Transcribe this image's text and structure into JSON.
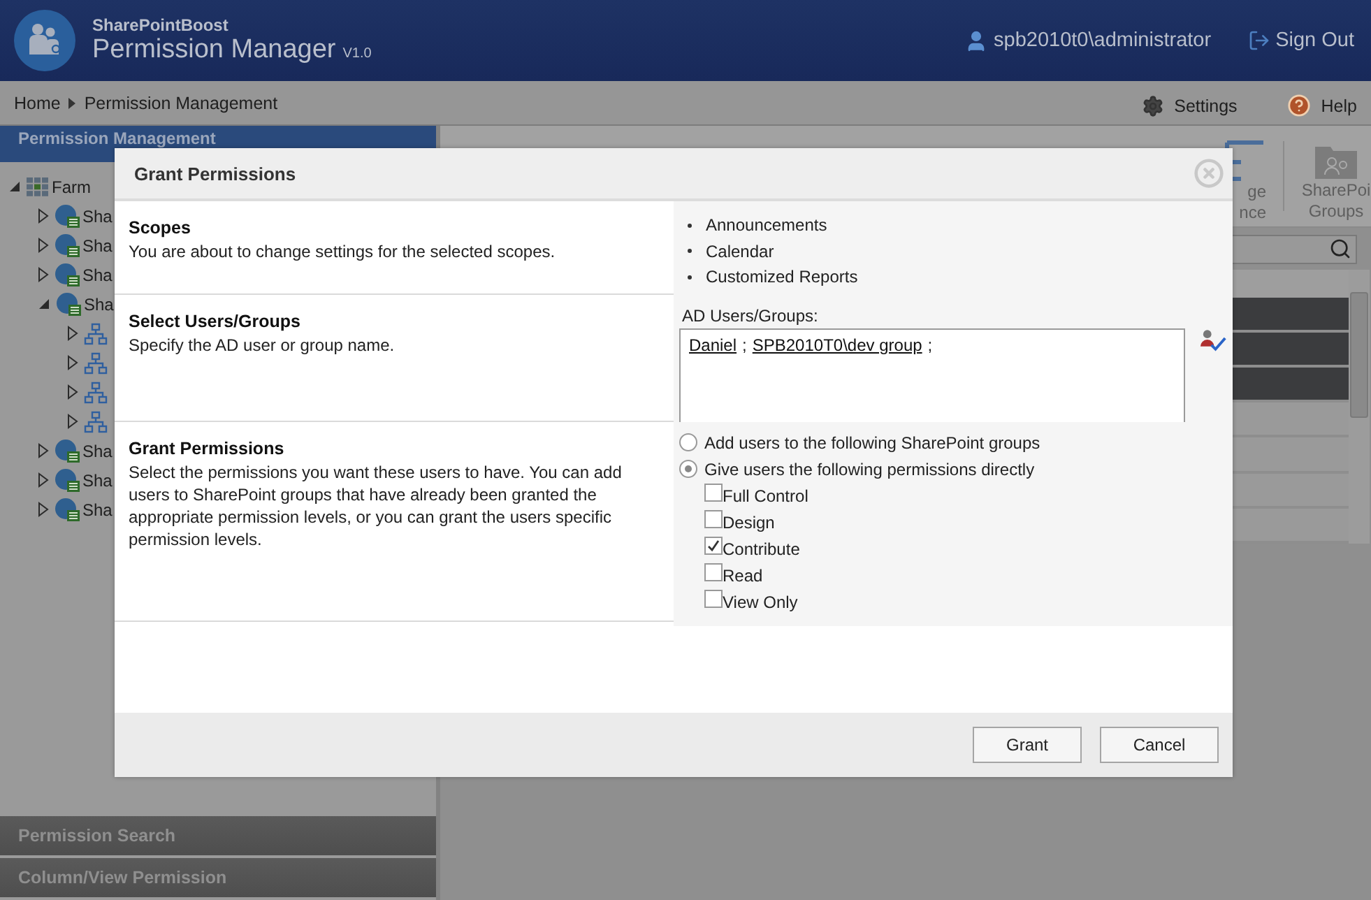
{
  "header": {
    "brand": "SharePointBoost",
    "product": "Permission Manager",
    "version": "V1.0",
    "user": "spb2010t0\\administrator",
    "sign_out": "Sign Out"
  },
  "breadcrumb": {
    "items": [
      "Home",
      "Permission Management"
    ],
    "settings": "Settings",
    "help": "Help"
  },
  "sidebar": {
    "title": "Permission Management",
    "tree": [
      {
        "label": "Farm",
        "kind": "farm",
        "expanded": true,
        "children": [
          {
            "label": "Sha",
            "kind": "site",
            "expanded": false
          },
          {
            "label": "Sha",
            "kind": "site",
            "expanded": false
          },
          {
            "label": "Sha",
            "kind": "site",
            "expanded": false
          },
          {
            "label": "Sha",
            "kind": "site",
            "expanded": true,
            "children": [
              {
                "kind": "web",
                "expanded": false
              },
              {
                "kind": "web",
                "expanded": false
              },
              {
                "kind": "web",
                "expanded": false
              },
              {
                "kind": "web",
                "expanded": false
              }
            ]
          },
          {
            "label": "Sha",
            "kind": "site",
            "expanded": false
          },
          {
            "label": "Sha",
            "kind": "site",
            "expanded": false
          },
          {
            "label": "Sha",
            "kind": "site",
            "expanded": false
          }
        ]
      }
    ],
    "panels": [
      "Permission Search",
      "Column/View Permission"
    ]
  },
  "toolbar": {
    "items": [
      {
        "kind": "inheritance",
        "lines": [
          "ge",
          "nce"
        ]
      },
      {
        "kind": "groups",
        "lines": [
          "SharePoi",
          "Groups"
        ]
      }
    ]
  },
  "list": {
    "rows": [
      {
        "selected": true
      },
      {
        "selected": true
      },
      {
        "selected": true
      },
      {
        "selected": false
      },
      {
        "selected": false
      },
      {
        "selected": false
      },
      {
        "selected": false
      }
    ]
  },
  "dialog": {
    "title": "Grant Permissions",
    "sections": [
      {
        "kind": "scopes",
        "title": "Scopes",
        "description": "You are about to change settings for the selected scopes.",
        "items": [
          "Announcements",
          "Calendar",
          "Customized Reports"
        ]
      },
      {
        "kind": "users",
        "title": "Select Users/Groups",
        "description": "Specify the AD user or group name.",
        "field_label": "AD Users/Groups:",
        "entries": [
          "Daniel",
          "SPB2010T0\\dev group"
        ],
        "separator": ";"
      },
      {
        "kind": "permissions",
        "title": "Grant Permissions",
        "description": "Select the permissions you want these users to have. You can add users to SharePoint groups that have already been granted the appropriate permission levels, or you can grant the users specific permission levels.",
        "options": [
          {
            "label": "Add users to the following SharePoint groups",
            "selected": false
          },
          {
            "label": "Give users the following permissions directly",
            "selected": true
          }
        ],
        "levels": [
          {
            "label": "Full Control",
            "checked": false
          },
          {
            "label": "Design",
            "checked": false
          },
          {
            "label": "Contribute",
            "checked": true
          },
          {
            "label": "Read",
            "checked": false
          },
          {
            "label": "View Only",
            "checked": false
          }
        ]
      }
    ],
    "buttons": [
      "Grant",
      "Cancel"
    ]
  }
}
